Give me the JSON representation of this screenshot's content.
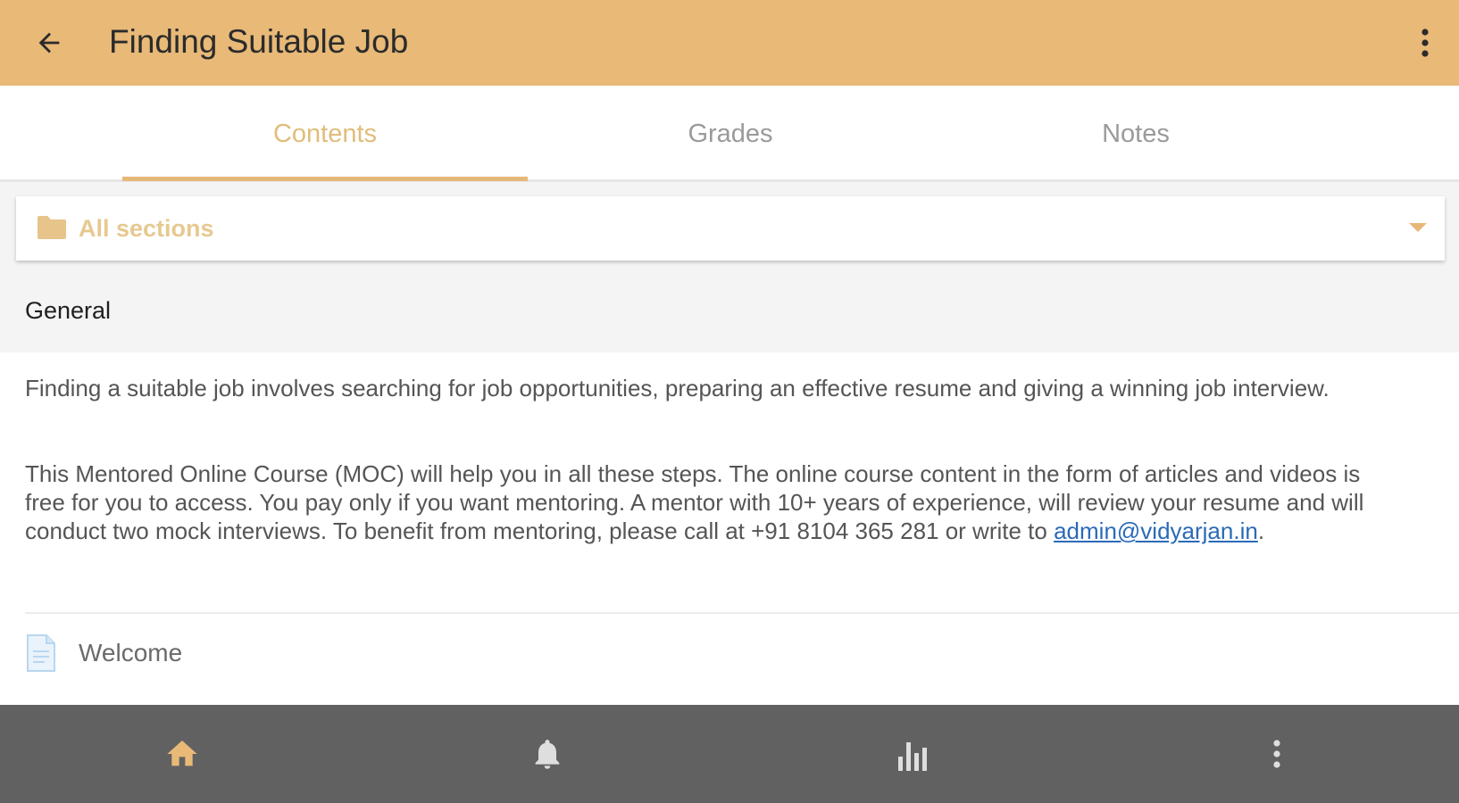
{
  "header": {
    "title": "Finding Suitable Job",
    "back_icon": "arrow-back-icon",
    "menu_icon": "more-vert-icon"
  },
  "tabs": [
    {
      "label": "Contents",
      "active": true
    },
    {
      "label": "Grades",
      "active": false
    },
    {
      "label": "Notes",
      "active": false
    }
  ],
  "section_selector": {
    "icon": "folder-icon",
    "selected": "All sections"
  },
  "section": {
    "name": "General",
    "summary_p1": "Finding a suitable job involves searching for job opportunities, preparing an effective resume and giving a winning job interview.",
    "summary_p2": "This Mentored Online Course (MOC) will help you in all these steps. The online course content in the form of articles and videos is free for you to access. You pay only if you want mentoring. A mentor with 10+ years of experience, will review your resume and will conduct two mock interviews. To benefit from mentoring, please call at +91 8104 365 281 or write to ",
    "email": "admin@vidyarjan.in",
    "email_suffix": "."
  },
  "modules": [
    {
      "name": "Welcome",
      "icon": "page-icon"
    }
  ],
  "bottom_nav": [
    {
      "icon": "home-icon",
      "active": true
    },
    {
      "icon": "notifications-icon",
      "active": false
    },
    {
      "icon": "grades-chart-icon",
      "active": false
    },
    {
      "icon": "more-vert-icon",
      "active": false
    }
  ],
  "colors": {
    "brand": "#e8b977",
    "accent_text": "#e0bd7a",
    "nav_bg": "#616161",
    "link": "#2a6ab8"
  }
}
